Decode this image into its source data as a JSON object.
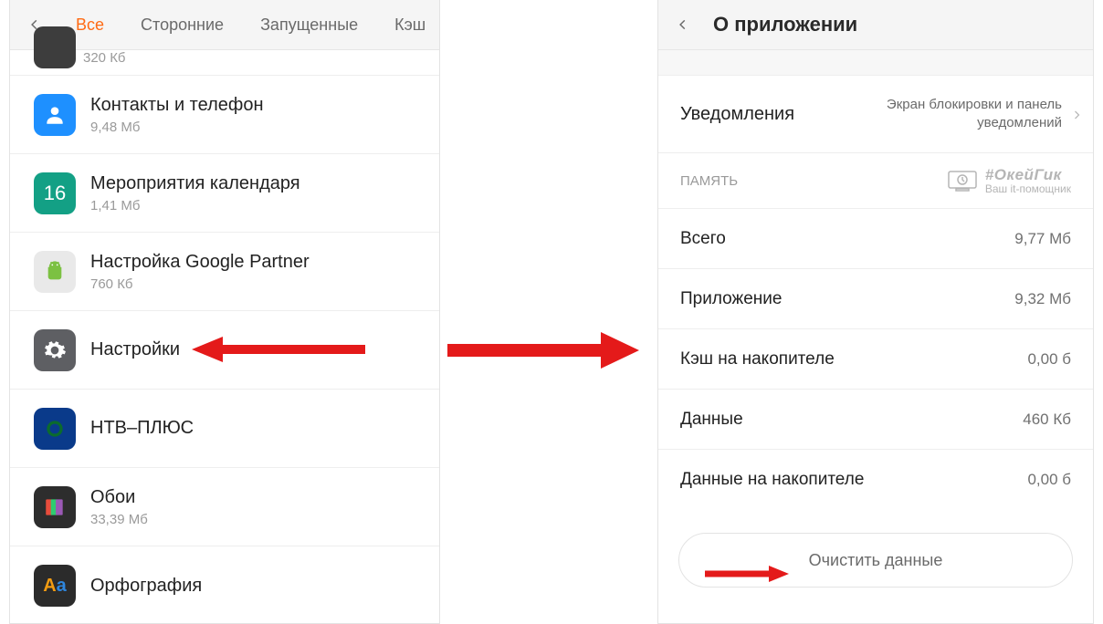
{
  "left": {
    "tabs": [
      "Все",
      "Сторонние",
      "Запущенные",
      "Кэш"
    ],
    "active_tab_index": 0,
    "partial_size": "320 Кб",
    "apps": [
      {
        "name": "Контакты и телефон",
        "size": "9,48 Мб",
        "icon": "contacts"
      },
      {
        "name": "Мероприятия календаря",
        "size": "1,41 Мб",
        "icon": "calendar",
        "icon_text": "16"
      },
      {
        "name": "Настройка Google Partner",
        "size": "760 Кб",
        "icon": "android"
      },
      {
        "name": "Настройки",
        "size": "",
        "icon": "settings"
      },
      {
        "name": "НТВ–ПЛЮС",
        "size": "",
        "icon": "ntv"
      },
      {
        "name": "Обои",
        "size": "33,39 Мб",
        "icon": "wallpaper"
      },
      {
        "name": "Орфография",
        "size": "",
        "icon": "spell",
        "icon_text": "Aa"
      }
    ]
  },
  "right": {
    "title": "О приложении",
    "notifications": {
      "label": "Уведомления",
      "value": "Экран блокировки и панель уведомлений"
    },
    "memory_section_label": "ПАМЯТЬ",
    "watermark": {
      "tag": "#ОкейГик",
      "sub": "Ваш it-помощник"
    },
    "rows": [
      {
        "k": "Всего",
        "v": "9,77 Мб"
      },
      {
        "k": "Приложение",
        "v": "9,32 Мб"
      },
      {
        "k": "Кэш на накопителе",
        "v": "0,00 б"
      },
      {
        "k": "Данные",
        "v": "460 Кб"
      },
      {
        "k": "Данные на накопителе",
        "v": "0,00 б"
      }
    ],
    "clear_label": "Очистить данные"
  },
  "annotations": {
    "arrow_color": "#e41a1a"
  }
}
